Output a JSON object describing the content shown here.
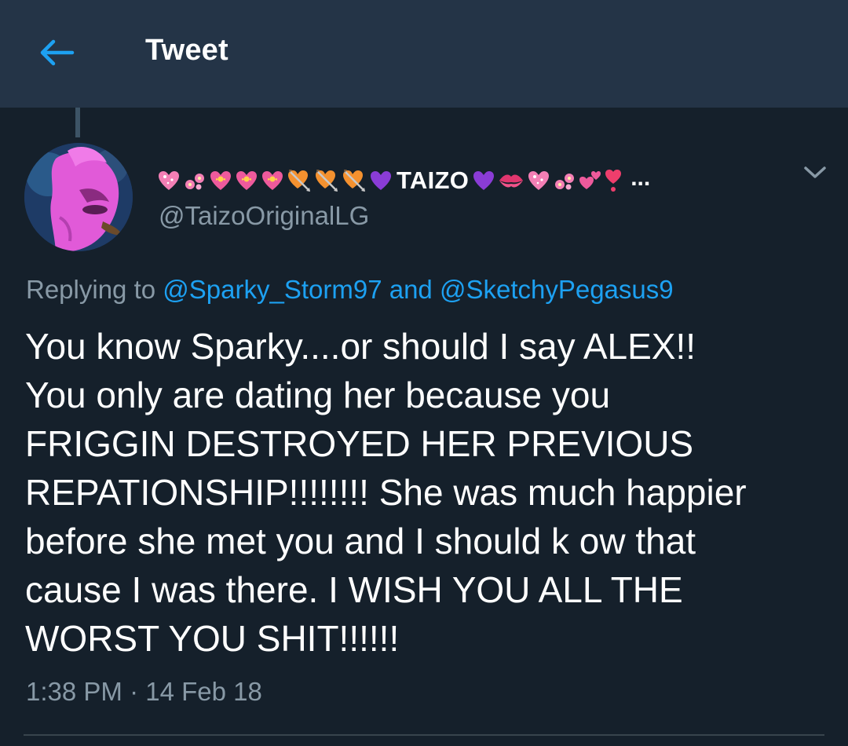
{
  "header": {
    "title": "Tweet",
    "back_icon": "arrow-left-icon",
    "accent_color": "#1da1f2",
    "bar_color": "#243447"
  },
  "tweet": {
    "author": {
      "display_name": "TAIZO",
      "name_prefix_emojis": [
        "sparkling-heart",
        "cherry-blossom",
        "heart-with-ribbon",
        "heart-with-ribbon",
        "heart-with-ribbon",
        "heart-with-arrow",
        "heart-with-arrow",
        "heart-with-arrow",
        "purple-heart"
      ],
      "name_suffix_emojis": [
        "purple-heart",
        "kiss-mark",
        "sparkling-heart",
        "cherry-blossom",
        "two-hearts",
        "heart-exclamation"
      ],
      "truncation": "...",
      "handle": "@TaizoOriginalLG",
      "avatar_icon": "pink-pony-avatar"
    },
    "reply_context": {
      "prefix": "Replying to ",
      "user1": "@Sparky_Storm97",
      "joiner": " and ",
      "user2": "@SketchyPegasus9"
    },
    "text_lines": [
      "You know Sparky....or should I say ALEX!!",
      "You only are dating her because you",
      "FRIGGIN DESTROYED HER PREVIOUS",
      "REPATIONSHIP!!!!!!!! She was much happier",
      "before she met you and I should k ow that",
      "cause I was there. I WISH YOU ALL THE",
      "WORST YOU SHIT!!!!!!"
    ],
    "timestamp": "1:38 PM · 14 Feb 18"
  },
  "colors": {
    "background": "#15202b",
    "secondary_text": "#8899a6",
    "link": "#1da1f2",
    "divider": "#38444d"
  }
}
